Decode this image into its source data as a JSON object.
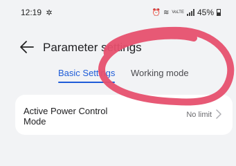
{
  "status_bar": {
    "time": "12:19",
    "time_icon": "fan-icon",
    "battery": "45%",
    "network_label": "VoLTE"
  },
  "header": {
    "title": "Parameter settings",
    "back_icon": "back-arrow-icon"
  },
  "tabs": [
    {
      "label": "Basic Settings",
      "active": true
    },
    {
      "label": "Working mode",
      "active": false
    }
  ],
  "settings": [
    {
      "label": "Active Power Control Mode",
      "value": "No limit",
      "icon": "chevron-right-icon"
    }
  ],
  "colors": {
    "accent": "#1e5cd8",
    "background": "#f2f3f5",
    "card": "#ffffff",
    "annotation": "#e6506e"
  },
  "annotation": {
    "shape": "hand-drawn-ellipse",
    "target": "Working mode"
  }
}
